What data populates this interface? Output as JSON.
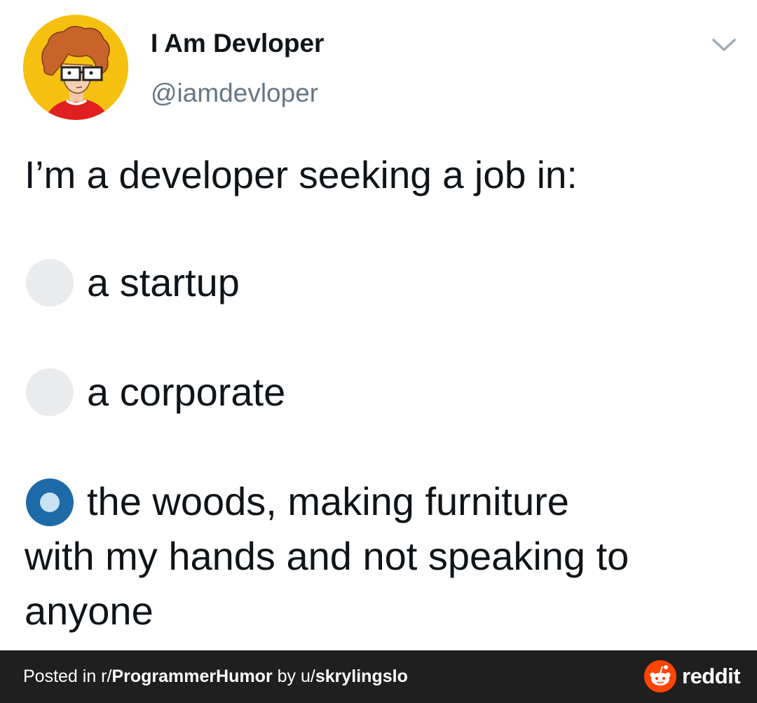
{
  "tweet": {
    "display_name": "I Am Devloper",
    "handle": "@iamdevloper",
    "text": "I’m a developer seeking a job in:",
    "menu_icon": "chevron-down-icon"
  },
  "poll": {
    "options": [
      {
        "label": "a startup",
        "selected": false
      },
      {
        "label": "a corporate",
        "selected": false
      },
      {
        "label_line1": "the woods, making furniture",
        "label_rest": "with my hands and not speaking to anyone",
        "selected": true
      }
    ]
  },
  "footer": {
    "prefix": "Posted in r/",
    "subreddit": "ProgrammerHumor",
    "by": " by u/",
    "user": "skrylingslo",
    "brand": "reddit"
  },
  "colors": {
    "avatar_bg": "#f5c010",
    "handle": "#657786",
    "radio_unselected": "#e9ebed",
    "radio_selected": "#1c6aa8",
    "footer_bg": "#1f1f1f",
    "reddit_orange": "#ff4500"
  }
}
